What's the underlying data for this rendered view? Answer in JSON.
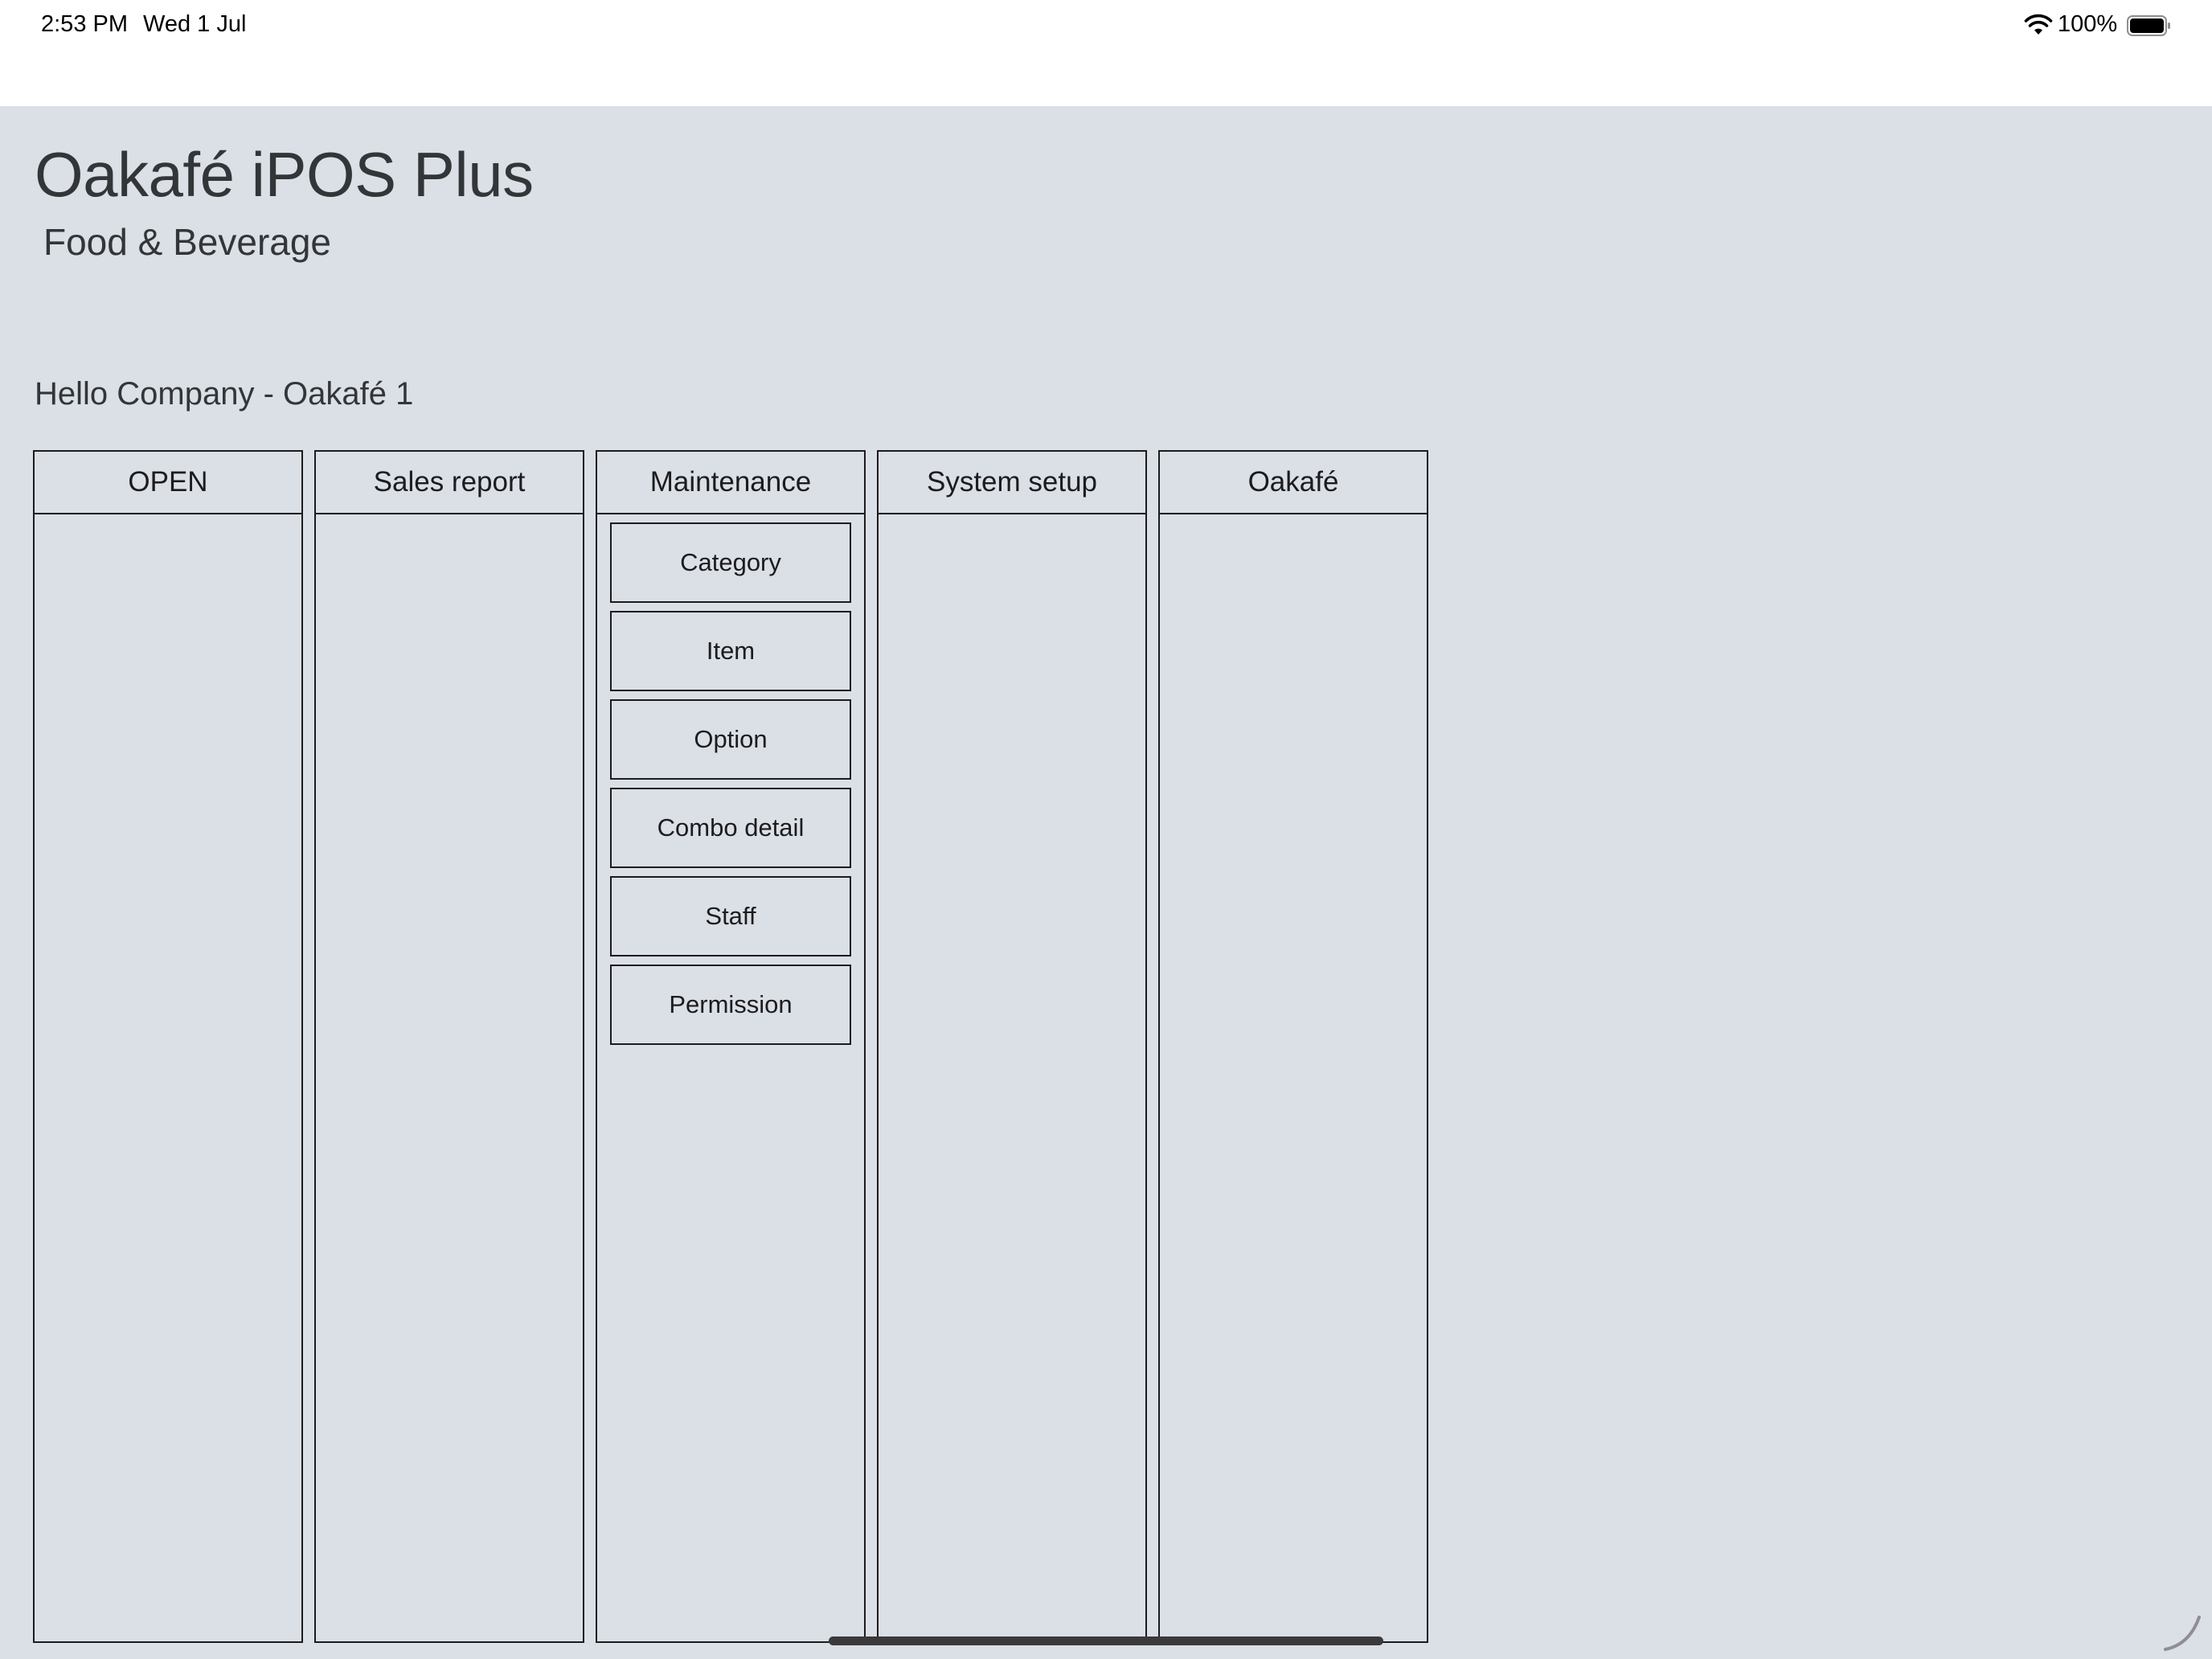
{
  "status_bar": {
    "time": "2:53 PM",
    "date": "Wed 1 Jul",
    "battery_percent": "100%",
    "icons": [
      "wifi-icon",
      "battery-icon"
    ]
  },
  "app": {
    "title": "Oakafé iPOS Plus",
    "subtitle": "Food & Beverage",
    "greeting": "Hello Company - Oakafé 1"
  },
  "columns": [
    {
      "header": "OPEN",
      "items": []
    },
    {
      "header": "Sales report",
      "items": []
    },
    {
      "header": "Maintenance",
      "items": [
        "Category",
        "Item",
        "Option",
        "Combo detail",
        "Staff",
        "Permission"
      ]
    },
    {
      "header": "System setup",
      "items": []
    },
    {
      "header": "Oakafé",
      "items": []
    }
  ],
  "colors": {
    "background": "#dbdfe6",
    "border": "#1c1c1e",
    "text": "#333638"
  }
}
